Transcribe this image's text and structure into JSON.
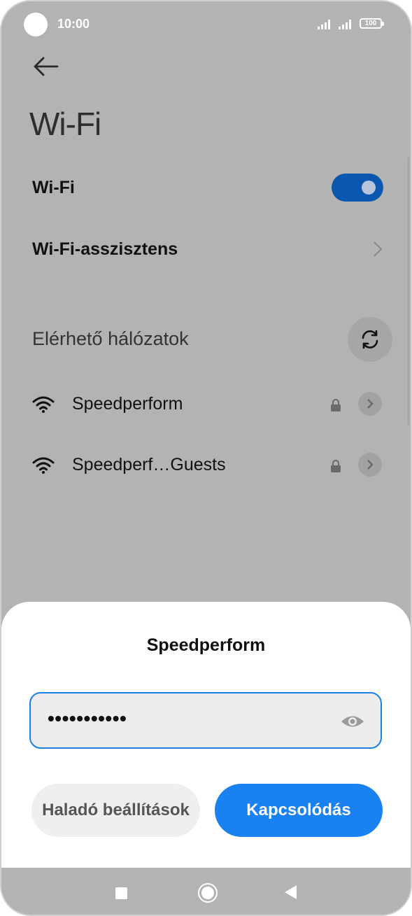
{
  "status_bar": {
    "time": "10:00",
    "battery": "100",
    "icons": [
      "camera-cutout",
      "signal-icon",
      "signal-icon",
      "battery-icon"
    ]
  },
  "header": {
    "back_icon": "arrow-left-icon",
    "title": "Wi-Fi"
  },
  "settings": {
    "wifi_label": "Wi-Fi",
    "wifi_enabled": true,
    "assistant_label": "Wi-Fi-asszisztens",
    "section_label": "Elérhető hálózatok",
    "refresh_icon": "refresh-icon"
  },
  "networks": [
    {
      "name": "Speedperform",
      "secured": true,
      "icon": "wifi-icon"
    },
    {
      "name": "Speedperf…Guests",
      "secured": true,
      "icon": "wifi-icon"
    }
  ],
  "dialog": {
    "title": "Speedperform",
    "password_value": "•••••••••••",
    "eye_icon": "eye-icon",
    "advanced_button": "Haladó beállítások",
    "connect_button": "Kapcsolódás"
  },
  "colors": {
    "accent": "#1a82f0",
    "toggle_on": "#0b57b0",
    "scrim": "#b3b3b3"
  },
  "nav_bar": {
    "icons": [
      "recents-icon",
      "home-icon",
      "back-icon"
    ]
  }
}
